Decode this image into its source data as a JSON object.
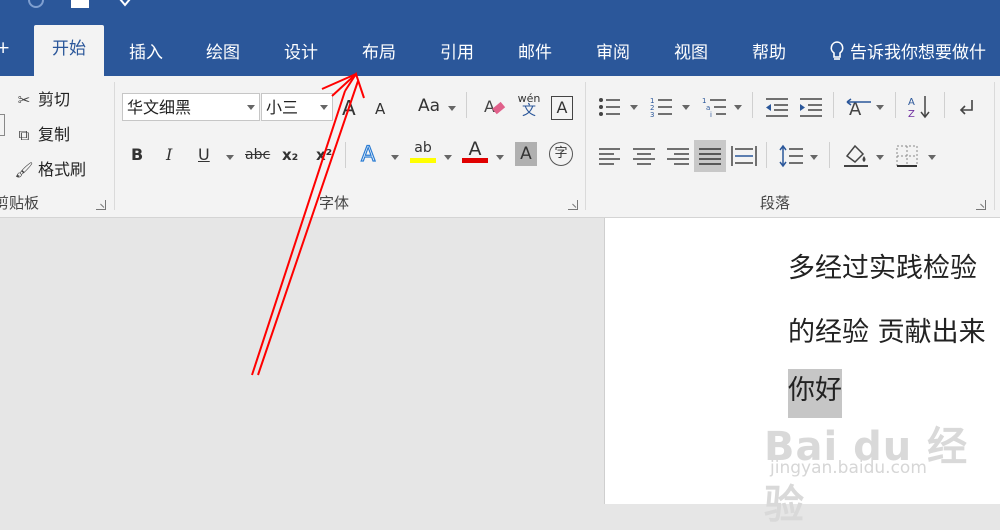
{
  "tabs": [
    "开始",
    "插入",
    "绘图",
    "设计",
    "布局",
    "引用",
    "邮件",
    "审阅",
    "视图",
    "帮助"
  ],
  "tell_me": "告诉我你想要做什",
  "clipboard": {
    "cut": "剪切",
    "copy": "复制",
    "format_painter": "格式刷",
    "group_label": "剪贴板"
  },
  "font": {
    "name": "华文细黑",
    "size": "小三",
    "grow": "A",
    "shrink": "A",
    "case": "Aa",
    "pinyin_top": "wén",
    "pinyin_bottom": "文",
    "border_char": "A",
    "bold": "B",
    "italic": "I",
    "underline": "U",
    "strike": "abc",
    "subscript": "x₂",
    "superscript": "x²",
    "effects": "A",
    "highlight": "ab",
    "color": "A",
    "shading": "A",
    "enclose": "字",
    "group_label": "字体",
    "highlight_color": "#ffff00",
    "font_color": "#e00000"
  },
  "paragraph": {
    "group_label": "段落"
  },
  "document": {
    "line1": "多经过实践检验",
    "line2": "的经验 贡献出来",
    "line3": "你好"
  },
  "watermark": {
    "brand": "Bai du 经验",
    "url": "jingyan.baidu.com"
  },
  "colors": {
    "ribbon_blue": "#2b579a",
    "annotation_red": "#ff0000"
  }
}
